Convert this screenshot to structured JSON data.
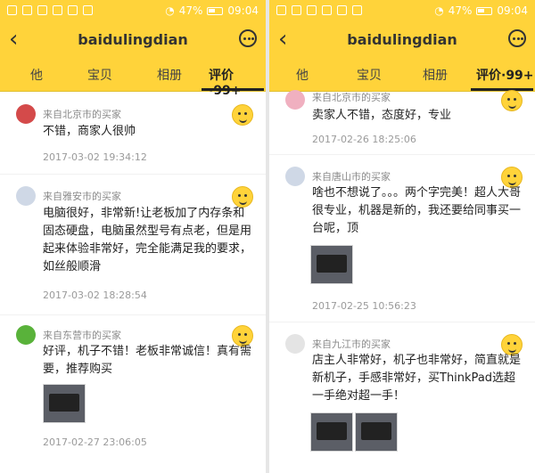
{
  "status": {
    "battery": "47%",
    "time": "09:04"
  },
  "header": {
    "title": "baidulingdian"
  },
  "tabs": [
    "他",
    "宝贝",
    "相册",
    "评价·99+"
  ],
  "colors": {
    "accent": "#ffd33a",
    "text": "#222222",
    "meta": "#8a8a8a"
  },
  "left_reviews": [
    {
      "buyer": "来自北京市的买家",
      "text": "不错，商家人很帅",
      "date": "2017-03-02 19:34:12"
    },
    {
      "buyer": "来自雅安市的买家",
      "text": "电脑很好，非常新!让老板加了内存条和固态硬盘，电脑虽然型号有点老，但是用起来体验非常好，完全能满足我的要求，如丝般顺滑",
      "date": "2017-03-02 18:28:54"
    },
    {
      "buyer": "来自东营市的买家",
      "text": "好评，机子不错！老板非常诚信！真有需要，推荐购买",
      "date": "2017-02-27 23:06:05"
    }
  ],
  "right_reviews": [
    {
      "buyer": "来自北京市的买家",
      "text": "卖家人不错，态度好，专业",
      "date": "2017-02-26 18:25:06"
    },
    {
      "buyer": "来自唐山市的买家",
      "text": "啥也不想说了。。。两个字完美！超人大哥很专业，机器是新的，我还要给同事买一台呢，顶",
      "date": "2017-02-25 10:56:23"
    },
    {
      "buyer": "来自九江市的买家",
      "text": "店主人非常好，机子也非常好，简直就是新机子，手感非常好，买ThinkPad选超一手绝对超一手！",
      "date": ""
    }
  ]
}
